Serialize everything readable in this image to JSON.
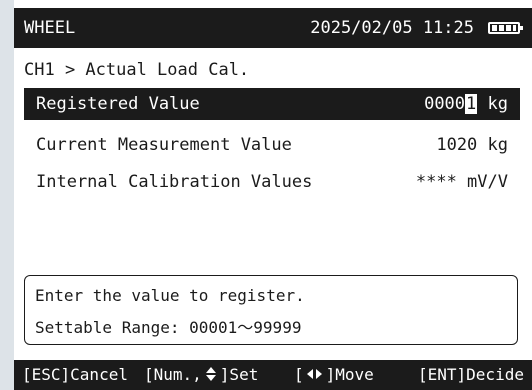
{
  "header": {
    "app_name": "WHEEL",
    "datetime": "2025/02/05 11:25",
    "battery_icon": "battery-full-icon"
  },
  "breadcrumb": "CH1 > Actual Load Cal.",
  "rows": [
    {
      "label": "Registered Value",
      "value_prefix": "0000",
      "value_cursor": "1",
      "value_unit": " kg",
      "selected": true
    },
    {
      "label": "Current Measurement Value",
      "value": "1020 kg"
    },
    {
      "label": "Internal Calibration Values",
      "value": "**** mV/V"
    }
  ],
  "message": {
    "line1": "Enter the value to register.",
    "line2": "Settable Range: 00001～99999"
  },
  "footer": {
    "esc": "[ESC]Cancel",
    "num_prefix": "[Num.,",
    "num_suffix": "]Set",
    "move_prefix": "[",
    "move_suffix": "]Move",
    "ent": "[ENT]Decide",
    "updown_icon": "up-down-arrows-icon",
    "leftright_icon": "left-right-arrows-icon"
  },
  "colors": {
    "background": "#dde3e8",
    "screen": "#ffffff",
    "dark": "#1b1b1b"
  }
}
